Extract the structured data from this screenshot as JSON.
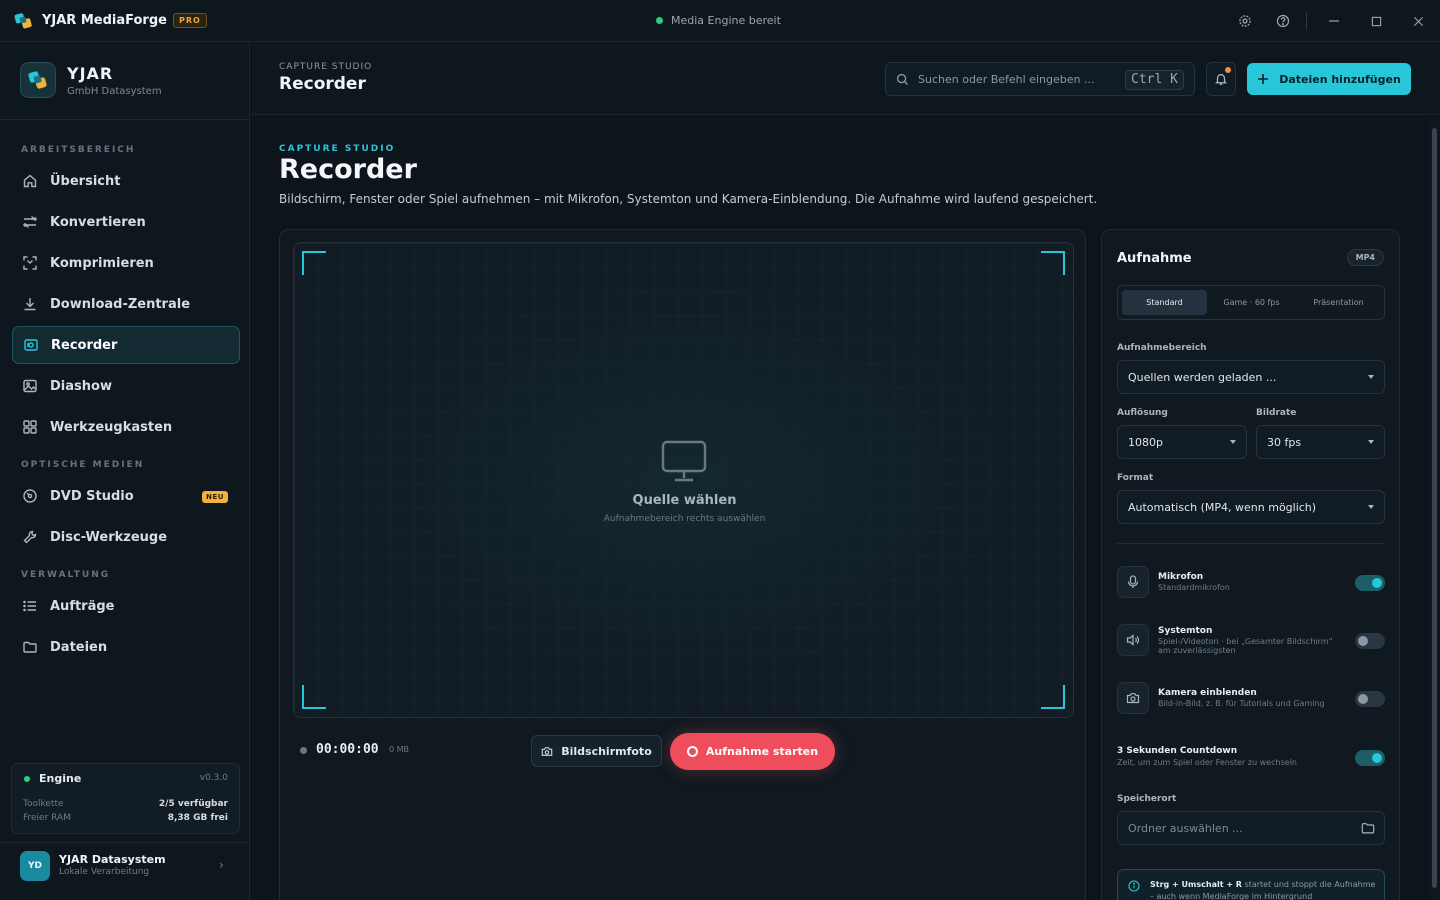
{
  "titlebar": {
    "app_name": "YJAR MediaForge",
    "badge": "PRO",
    "status": "Media Engine bereit"
  },
  "brand": {
    "name": "YJAR",
    "subtitle": "GmbH Datasystem"
  },
  "nav": {
    "section_workspace": "ARBEITSBEREICH",
    "section_optical": "OPTISCHE MEDIEN",
    "section_admin": "VERWALTUNG",
    "items": [
      {
        "label": "Übersicht",
        "icon": "home-icon"
      },
      {
        "label": "Konvertieren",
        "icon": "convert-icon"
      },
      {
        "label": "Komprimieren",
        "icon": "compress-icon"
      },
      {
        "label": "Download-Zentrale",
        "icon": "download-icon"
      },
      {
        "label": "Recorder",
        "icon": "record-icon",
        "active": true
      },
      {
        "label": "Diashow",
        "icon": "image-icon"
      },
      {
        "label": "Werkzeugkasten",
        "icon": "grid-icon"
      },
      {
        "label": "DVD Studio",
        "icon": "disc-icon",
        "badge": "NEU"
      },
      {
        "label": "Disc-Werkzeuge",
        "icon": "tool-icon"
      },
      {
        "label": "Aufträge",
        "icon": "list-icon"
      },
      {
        "label": "Dateien",
        "icon": "folder-icon"
      }
    ]
  },
  "engine": {
    "title": "Engine",
    "version": "v0.3.0",
    "toolchain_label": "Toolkette",
    "toolchain_value": "2/5 verfügbar",
    "ram_label": "Freier RAM",
    "ram_value": "8,38 GB frei"
  },
  "user": {
    "initials": "YD",
    "name": "YJAR Datasystem",
    "subtitle": "Lokale Verarbeitung"
  },
  "header": {
    "eyebrow": "CAPTURE STUDIO",
    "title": "Recorder",
    "search_placeholder": "Suchen oder Befehl eingeben ...",
    "shortcut": "Ctrl K",
    "add_button": "Dateien hinzufügen"
  },
  "page": {
    "eyebrow": "CAPTURE STUDIO",
    "title": "Recorder",
    "description": "Bildschirm, Fenster oder Spiel aufnehmen – mit Mikrofon, Systemton und Kamera-Einblendung. Die Aufnahme wird laufend gespeichert."
  },
  "preview": {
    "title": "Quelle wählen",
    "subtitle": "Aufnahmebereich rechts auswählen"
  },
  "controls": {
    "timer": "00:00:00",
    "size": "0 MB",
    "snapshot_button": "Bildschirmfoto",
    "record_button": "Aufnahme starten"
  },
  "settings": {
    "title": "Aufnahme",
    "format_badge": "MP4",
    "presets": [
      "Standard",
      "Game · 60 fps",
      "Präsentation"
    ],
    "area_label": "Aufnahmebereich",
    "area_value": "Quellen werden geladen ...",
    "resolution_label": "Auflösung",
    "resolution_value": "1080p",
    "framerate_label": "Bildrate",
    "framerate_value": "30 fps",
    "format_label": "Format",
    "format_value": "Automatisch (MP4, wenn möglich)",
    "mic_title": "Mikrofon",
    "mic_sub": "Standardmikrofon",
    "mic_on": true,
    "sys_title": "Systemton",
    "sys_sub": "Spiel-/Videoton · bei „Gesamter Bildschirm“ am zuverlässigsten",
    "sys_on": false,
    "cam_title": "Kamera einblenden",
    "cam_sub": "Bild-in-Bild, z. B. für Tutorials und Gaming",
    "cam_on": false,
    "countdown_title": "3 Sekunden Countdown",
    "countdown_sub": "Zeit, um zum Spiel oder Fenster zu wechseln",
    "countdown_on": true,
    "location_label": "Speicherort",
    "location_placeholder": "Ordner auswählen ...",
    "hint_keys": "Strg + Umschalt + R",
    "hint_text": "startet und stoppt die Aufnahme – auch wenn MediaForge im Hintergrund"
  },
  "colors": {
    "accent": "#27c6d9",
    "record": "#ef4d5b",
    "status_ok": "#2bd07a",
    "badge": "#f2b03d"
  }
}
